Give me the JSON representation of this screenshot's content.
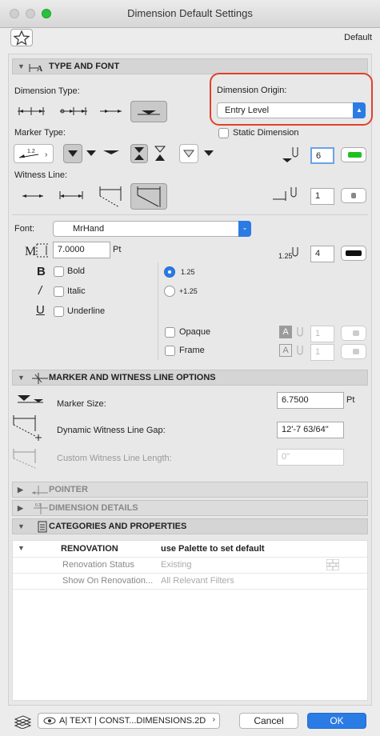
{
  "window": {
    "title": "Dimension Default Settings"
  },
  "header": {
    "preset_label": "Default"
  },
  "sections": {
    "type_font": "TYPE AND FONT",
    "marker_witness": "MARKER AND WITNESS LINE OPTIONS",
    "pointer": "POINTER",
    "dimension_details": "DIMENSION DETAILS",
    "categories": "CATEGORIES AND PROPERTIES"
  },
  "type_font": {
    "dimension_type_label": "Dimension Type:",
    "dimension_origin_label": "Dimension Origin:",
    "dimension_origin_value": "Entry Level",
    "static_dimension_label": "Static Dimension",
    "marker_type_label": "Marker Type:",
    "marker_pen": "6",
    "witness_line_label": "Witness Line:",
    "witness_pen": "1",
    "font_label": "Font:",
    "font_value": "MrHand",
    "font_size": "7.0000",
    "font_size_unit": "Pt",
    "text_pen": "4",
    "bold_label": "Bold",
    "italic_label": "Italic",
    "underline_label": "Underline",
    "radio_1": "1.25",
    "radio_2": "+1.25",
    "opaque_label": "Opaque",
    "opaque_pen": "1",
    "frame_label": "Frame",
    "frame_pen": "1",
    "size_icon_text": "1.25"
  },
  "marker_witness": {
    "marker_size_label": "Marker Size:",
    "marker_size_value": "6.7500",
    "marker_size_unit": "Pt",
    "gap_label": "Dynamic Witness Line Gap:",
    "gap_value": "12'-7 63/64\"",
    "custom_length_label": "Custom Witness Line Length:",
    "custom_length_value": "0\""
  },
  "categories": {
    "header_name": "RENOVATION",
    "header_value": "use Palette to set default",
    "rows": [
      {
        "name": "Renovation Status",
        "value": "Existing"
      },
      {
        "name": "Show On Renovation...",
        "value": "All Relevant Filters"
      }
    ]
  },
  "footer": {
    "layer_value": "A| TEXT | CONST...DIMENSIONS.2D",
    "cancel_label": "Cancel",
    "ok_label": "OK"
  },
  "colors": {
    "accent": "#2b7be4",
    "highlight_ring": "#e0412c",
    "pen_green": "#1ec21e"
  }
}
